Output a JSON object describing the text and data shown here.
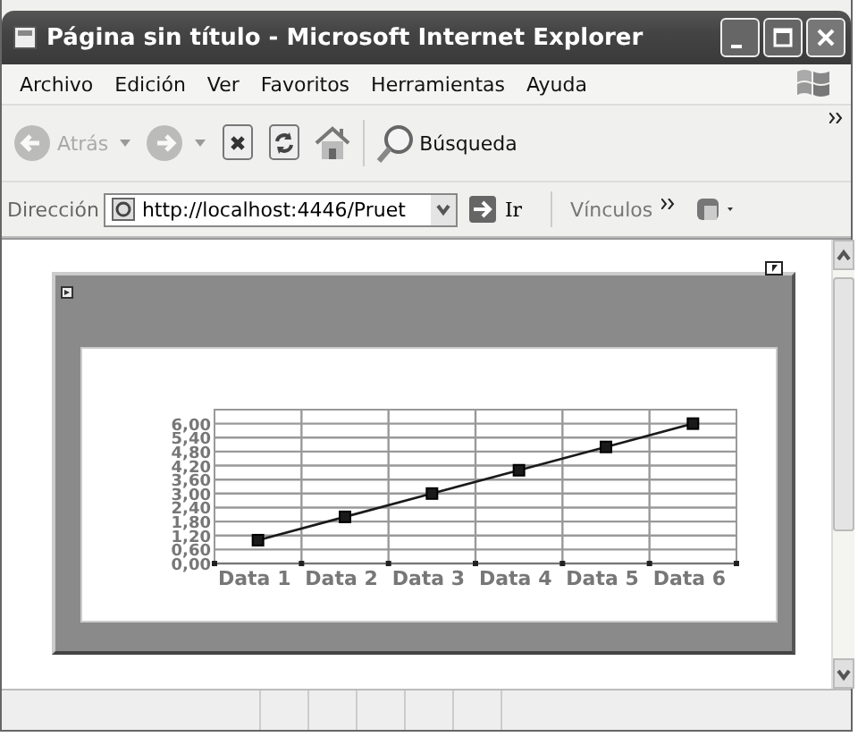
{
  "window": {
    "title": "Página sin título - Microsoft Internet Explorer"
  },
  "menu": [
    "Archivo",
    "Edición",
    "Ver",
    "Favoritos",
    "Herramientas",
    "Ayuda"
  ],
  "toolbar": [
    {
      "kind": "back",
      "label": "Atrás",
      "disabled": true
    },
    {
      "kind": "forward",
      "disabled": true
    },
    {
      "kind": "stop",
      "disabled": false
    },
    {
      "kind": "refresh",
      "disabled": false
    },
    {
      "kind": "home",
      "disabled": false
    },
    {
      "kind": "search",
      "label": "Búsqueda",
      "disabled": false
    }
  ],
  "address_bar": {
    "label": "Dirección",
    "value": "http://localhost:4446/Pruet",
    "go": "Ir",
    "links": "Vínculos"
  },
  "page": {
    "chart_data": {
      "type": "line",
      "categories": [
        "Data 1",
        "Data 2",
        "Data 3",
        "Data 4",
        "Data 5",
        "Data 6"
      ],
      "grid": true,
      "series": [
        {
          "color": "#1a1a1a",
          "marker": "square",
          "values": [
            1,
            2,
            3,
            4,
            5,
            6
          ]
        }
      ],
      "ylim": [
        0,
        6.6
      ],
      "yticks": [
        {
          "value": 0,
          "label": "0,00"
        },
        {
          "value": 0.6,
          "label": "0,60"
        },
        {
          "value": 1.2,
          "label": "1,20"
        },
        {
          "value": 1.8,
          "label": "1,80"
        },
        {
          "value": 2.4,
          "label": "2,40"
        },
        {
          "value": 3,
          "label": "3,00"
        },
        {
          "value": 3.6,
          "label": "3,60"
        },
        {
          "value": 4.2,
          "label": "4,20"
        },
        {
          "value": 4.8,
          "label": "4,80"
        },
        {
          "value": 5.4,
          "label": "5,40"
        },
        {
          "value": 6,
          "label": "6,00"
        }
      ]
    }
  }
}
